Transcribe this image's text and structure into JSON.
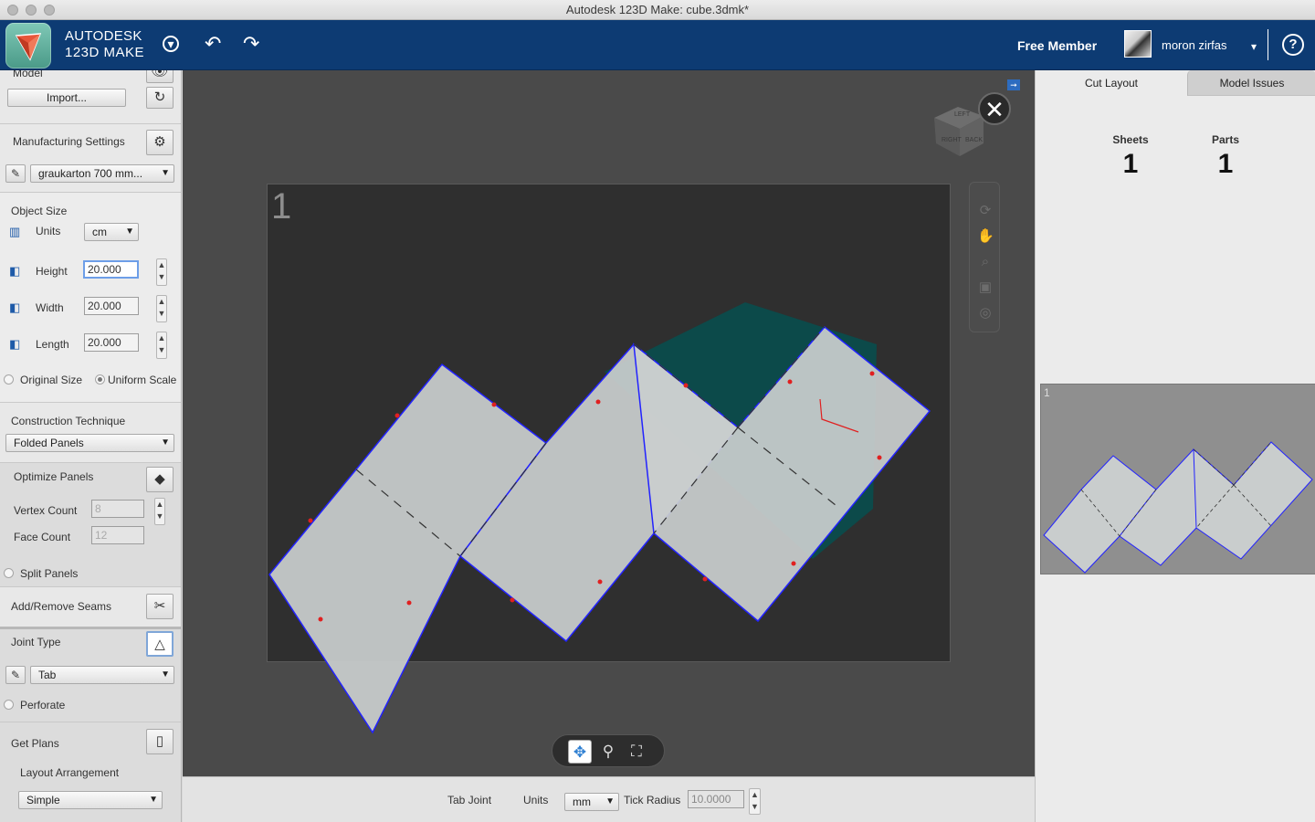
{
  "window": {
    "title": "Autodesk 123D Make: cube.3dmk*"
  },
  "header": {
    "brand_line1": "AUTODESK",
    "brand_line2": "123D MAKE",
    "membership": "Free Member",
    "username": "moron zirfas",
    "help_glyph": "?",
    "accent": "#0d3b73"
  },
  "left": {
    "model": {
      "label": "Model",
      "import_label": "Import..."
    },
    "manufacturing": {
      "label": "Manufacturing Settings",
      "material": "graukarton 700 mm..."
    },
    "object_size": {
      "label": "Object Size",
      "units_label": "Units",
      "units_value": "cm",
      "height_label": "Height",
      "height_value": "20.000",
      "width_label": "Width",
      "width_value": "20.000",
      "length_label": "Length",
      "length_value": "20.000",
      "original_size": "Original Size",
      "uniform_scale": "Uniform Scale"
    },
    "construction": {
      "label": "Construction Technique",
      "value": "Folded Panels"
    },
    "optimize": {
      "label": "Optimize Panels",
      "vertex_label": "Vertex Count",
      "vertex_value": "8",
      "face_label": "Face Count",
      "face_value": "12",
      "split_label": "Split Panels"
    },
    "seams": {
      "label": "Add/Remove Seams"
    },
    "joint": {
      "label": "Joint Type",
      "value": "Tab",
      "perforate": "Perforate"
    },
    "plans": {
      "label": "Get Plans",
      "layout_label": "Layout Arrangement",
      "layout_value": "Simple"
    }
  },
  "viewport": {
    "sheet_number": "1",
    "close_glyph": "✕",
    "viewcube_faces": [
      "LEFT",
      "RIGHT",
      "BACK"
    ]
  },
  "propbar": {
    "tab_joint": "Tab Joint",
    "units_label": "Units",
    "units_value": "mm",
    "tick_radius_label": "Tick Radius",
    "tick_radius_value": "10.0000"
  },
  "right": {
    "tab_cut_layout": "Cut Layout",
    "tab_model_issues": "Model Issues",
    "sheets_label": "Sheets",
    "sheets_value": "1",
    "parts_label": "Parts",
    "parts_value": "1",
    "thumb_number": "1"
  }
}
